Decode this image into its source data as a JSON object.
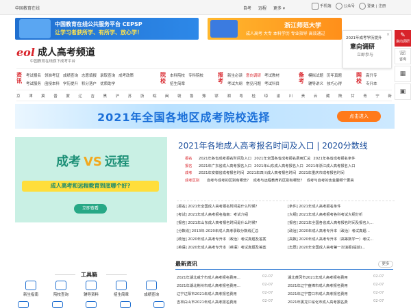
{
  "topbar": {
    "site_name": "中国教育在线",
    "links": [
      "自考",
      "远程",
      "更多"
    ],
    "right": [
      "手机端",
      "公众号",
      "登录 | 注册"
    ]
  },
  "banners": {
    "b1_line1": "中国教育在线公共服务平台 CEPSP",
    "b1_line2": "让学习者获所学、有所学、放心学！",
    "b2_title": "浙江师范大学",
    "b2_sub": "成人高考 大专 本科学历 专业指导 高效通过"
  },
  "logo": {
    "mark": "eol",
    "name": "成人高考频道",
    "sub": "中国教育在线旗下成考平台"
  },
  "popup": {
    "line1": "2021年成考学历提升",
    "line2": "意向调研",
    "line3": "立即参与",
    "close": "×"
  },
  "side": [
    {
      "label": "意向调研",
      "icon": "survey-icon"
    },
    {
      "label": "咨询",
      "icon": "chat-icon"
    },
    {
      "label": "",
      "icon": "grid-icon"
    },
    {
      "label": "",
      "icon": "qr-icon"
    }
  ],
  "nav": {
    "groups": [
      {
        "cap": "资讯",
        "row1": [
          "考试报名",
          "领准考证",
          "成绩查询",
          "志愿填报",
          "录取查询",
          "成考政策"
        ],
        "row2": [
          "考试服务",
          "函授本科",
          "学历提升",
          "积分落户",
          "优质助学"
        ]
      },
      {
        "cap": "院校",
        "row1": [
          "本科院校",
          "专科院校"
        ],
        "row2": [
          "招生简章"
        ]
      },
      {
        "cap": "报考",
        "row1": [
          "新生必读",
          "意向调研",
          "考试教材"
        ],
        "row2": [
          "考试大纲",
          "常见问题",
          "考试科目"
        ]
      },
      {
        "cap": "备考",
        "row1": [
          "模拟试题",
          "历年真题"
        ],
        "row2": [
          "辅导讲义",
          "技巧心得"
        ]
      },
      {
        "cap": "网校",
        "row1": [
          "高升专"
        ],
        "row2": [
          "专升本"
        ]
      }
    ],
    "highlight": "意向调研"
  },
  "provinces": [
    "京",
    "津",
    "冀",
    "晋",
    "蒙",
    "辽",
    "吉",
    "黑",
    "沪",
    "苏",
    "浙",
    "皖",
    "闽",
    "赣",
    "鲁",
    "豫",
    "鄂",
    "湘",
    "粤",
    "桂",
    "琼",
    "渝",
    "川",
    "贵",
    "云",
    "藏",
    "陕",
    "甘",
    "青",
    "宁",
    "新"
  ],
  "bigbanner": {
    "title": "2021年全国各地区成考院校选择",
    "button": "点击进入"
  },
  "promo": {
    "a": "成考",
    "vs": "VS",
    "b": "远程",
    "question": "成人高考和远程教育到底哪个好?",
    "button": "立即查看"
  },
  "headline": "2021年各地成人高考报名时间及入口 | 2020分数线",
  "hot": [
    {
      "k": "报名",
      "items": [
        "2021年各省成考报名时间及入口",
        "2021年全国各省成考报名费用汇总",
        "2021年各省成考报名条件"
      ]
    },
    {
      "k": "报名",
      "items": [
        "2021年广东省成人高考报名入口",
        "2021年山东成人高考报名入口",
        "2021年浙江成人高考报名入口"
      ]
    },
    {
      "k": "成考",
      "items": [
        "2021年安徽省成考报名时间",
        "2021年四川成人高考报名时间",
        "2021年重庆市成考报名时间"
      ]
    },
    {
      "k": "成考区别",
      "items": [
        "自考与成考的区别有哪些？",
        "成考与远程教育的区别有哪些？",
        "成考与自考的含金量哪个更高"
      ]
    }
  ],
  "grid": [
    "[报名] 2021年全国成人高考报名时间是什么时候？",
    "[条件] 2021年成人高考报名条件",
    "[考试] 2021年成人高考报名指南：考试介绍",
    "[大纲] 2021年成人高考报考各科考试大纲分析",
    "[报名] 2021年山东成人高考报名时间是什么时候？",
    "[报名] 2021年全国各省成人高考报名时间及报名入…",
    "[分数线] 2013年-2020年成人高考录取分数线汇总",
    "[政治] 2020年成人高考专升本（政治）考试真题…",
    "[政治] 2020年成人高考专升本（政治）考试真题及答案",
    "[高数] 2020年成人高考专升本（高等数学一）考试…",
    "[英语] 2020年成人高考专升本（英语）考试真题及答案",
    "[志愿] 2020年全国成人高考第一次填报(提前)…"
  ],
  "latest": {
    "title": "最新资讯",
    "more": "更多",
    "items": [
      {
        "t": "2021年湖北咸宁市成人高考报名费用…",
        "d": "02-07"
      },
      {
        "t": "湖北黄冈市2021年成人高考报名费用",
        "d": "02-07"
      },
      {
        "t": "2021年湖北荆州市成人高考报名费用…",
        "d": "02-07"
      },
      {
        "t": "2021年辽宁盘锦市成人高考报名费用",
        "d": "02-07"
      },
      {
        "t": "辽宁辽阳市2021年成人高考报名费用",
        "d": "02-07"
      },
      {
        "t": "2021年辽宁营口市成人高考报名费用",
        "d": "02-07"
      },
      {
        "t": "吉林白山市2021年成人高考报名费用",
        "d": "02-07"
      },
      {
        "t": "2021年黑龙江绥化市成人高考报名费",
        "d": "02-07"
      }
    ]
  },
  "tools": {
    "title": "工具箱",
    "items": [
      "新生指南",
      "院校查询",
      "辅导资料",
      "招生简章",
      "成绩查询"
    ]
  }
}
